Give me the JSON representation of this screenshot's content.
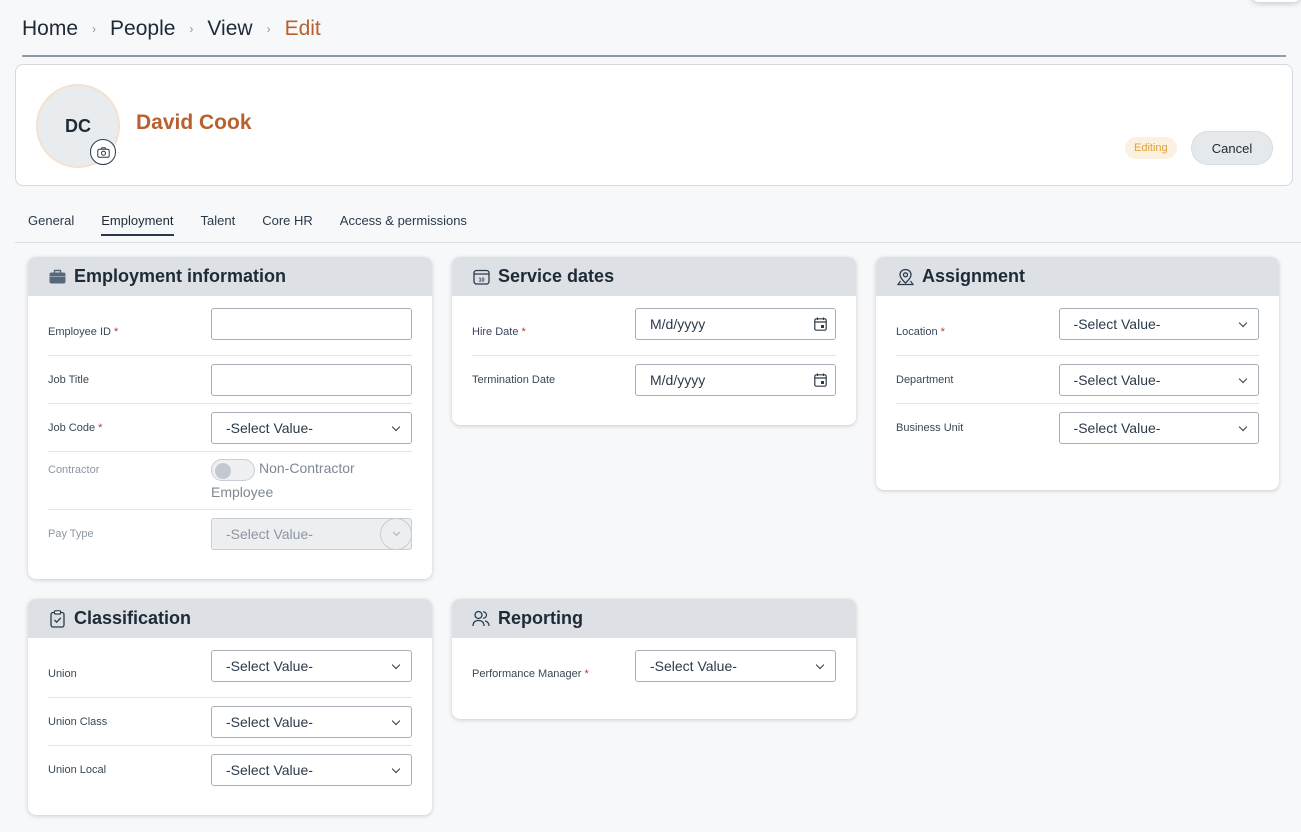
{
  "breadcrumb": {
    "items": [
      "Home",
      "People",
      "View",
      "Edit"
    ],
    "separator": "›"
  },
  "profile": {
    "initials": "DC",
    "name": "David Cook",
    "status_badge": "Editing",
    "cancel_label": "Cancel"
  },
  "tabs": [
    "General",
    "Employment",
    "Talent",
    "Core HR",
    "Access & permissions"
  ],
  "active_tab": "Employment",
  "employment_info": {
    "title": "Employment information",
    "employee_id_label": "Employee ID",
    "employee_id_value": "",
    "job_title_label": "Job Title",
    "job_title_value": "",
    "job_code_label": "Job Code",
    "job_code_value": "-Select Value-",
    "contractor_label": "Contractor",
    "contractor_value": "Non-Contractor Employee",
    "pay_type_label": "Pay Type",
    "pay_type_value": "-Select Value-"
  },
  "service_dates": {
    "title": "Service dates",
    "hire_date_label": "Hire Date",
    "hire_date_placeholder": "M/d/yyyy",
    "termination_date_label": "Termination Date",
    "termination_date_placeholder": "M/d/yyyy"
  },
  "assignment": {
    "title": "Assignment",
    "location_label": "Location",
    "location_value": "-Select Value-",
    "department_label": "Department",
    "department_value": "-Select Value-",
    "business_unit_label": "Business Unit",
    "business_unit_value": "-Select Value-"
  },
  "classification": {
    "title": "Classification",
    "union_label": "Union",
    "union_value": "-Select Value-",
    "union_class_label": "Union Class",
    "union_class_value": "-Select Value-",
    "union_local_label": "Union Local",
    "union_local_value": "-Select Value-"
  },
  "reporting": {
    "title": "Reporting",
    "performance_manager_label": "Performance Manager",
    "performance_manager_value": "-Select Value-"
  },
  "colors": {
    "accent": "#b8612f",
    "required": "#c0392b",
    "badge_text": "#e2a037",
    "card_header": "#dde1e5"
  },
  "icons": {
    "breadcrumb_separator": "chevron-right-icon",
    "avatar_camera": "camera-icon",
    "employment": "briefcase-icon",
    "service_dates": "calendar-icon",
    "assignment": "location-pin-icon",
    "classification": "clipboard-check-icon",
    "reporting": "users-icon",
    "date_picker": "calendar-icon",
    "dropdown": "chevron-down-icon"
  }
}
